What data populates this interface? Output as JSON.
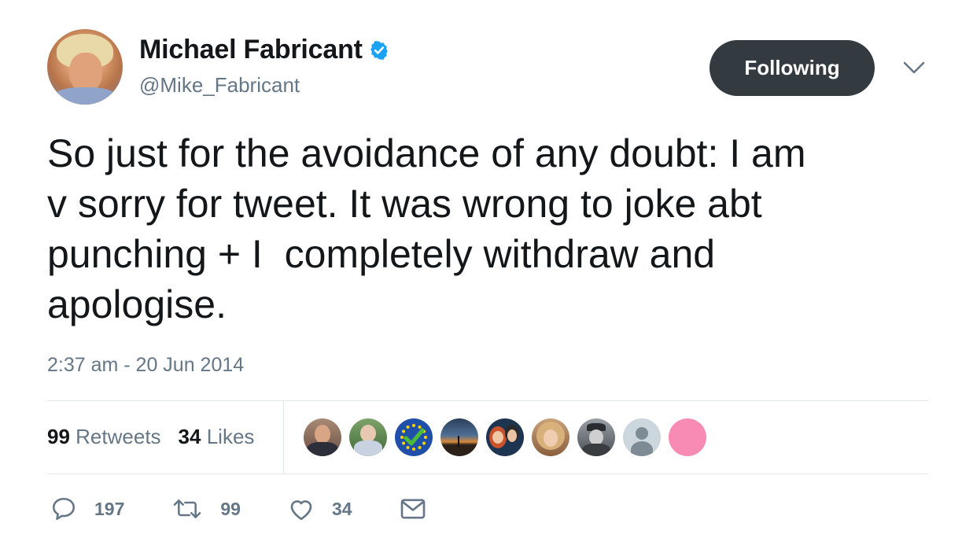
{
  "author": {
    "name": "Michael Fabricant",
    "handle": "@Mike_Fabricant",
    "verified": true
  },
  "follow_button": {
    "label": "Following"
  },
  "tweet": {
    "text": "So just for the avoidance of any doubt: I am\nv sorry for tweet. It was wrong to joke abt\npunching + I  completely withdraw and\napologise.",
    "timestamp": "2:37 am - 20 Jun 2014"
  },
  "stats": {
    "retweets_count": "99",
    "retweets_label": "Retweets",
    "likes_count": "34",
    "likes_label": "Likes"
  },
  "liker_avatars": [
    "avatar-man-suit",
    "avatar-man-outdoors",
    "avatar-eu-flag-check",
    "avatar-sunset-landscape",
    "avatar-couple-photo",
    "avatar-woman-blonde",
    "avatar-soldier-bw",
    "avatar-default-silhouette",
    "avatar-pink-circle"
  ],
  "actions": {
    "reply_count": "197",
    "retweet_count": "99",
    "like_count": "34"
  },
  "colors": {
    "text": "#14171a",
    "secondary": "#657786",
    "verified_blue": "#1da1f2",
    "button_bg": "#333a40",
    "divider": "#e1e8ed",
    "pink_avatar": "#f78bb4"
  }
}
